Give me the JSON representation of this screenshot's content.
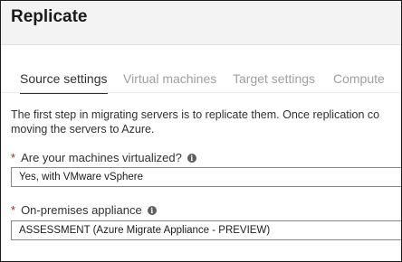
{
  "header": {
    "title": "Replicate"
  },
  "tabs": [
    {
      "label": "Source settings",
      "active": true
    },
    {
      "label": "Virtual machines",
      "active": false
    },
    {
      "label": "Target settings",
      "active": false
    },
    {
      "label": "Compute",
      "active": false
    }
  ],
  "intro": {
    "line1": "The first step in migrating servers is to replicate them. Once replication co",
    "line2": "moving the servers to Azure."
  },
  "virtualized": {
    "required_marker": "*",
    "label": "Are your machines virtualized?",
    "value": "Yes, with VMware vSphere"
  },
  "appliance": {
    "required_marker": "*",
    "label": "On-premises appliance",
    "value": "ASSESSMENT (Azure Migrate Appliance - PREVIEW)"
  },
  "icons": {
    "info": "info-icon"
  }
}
